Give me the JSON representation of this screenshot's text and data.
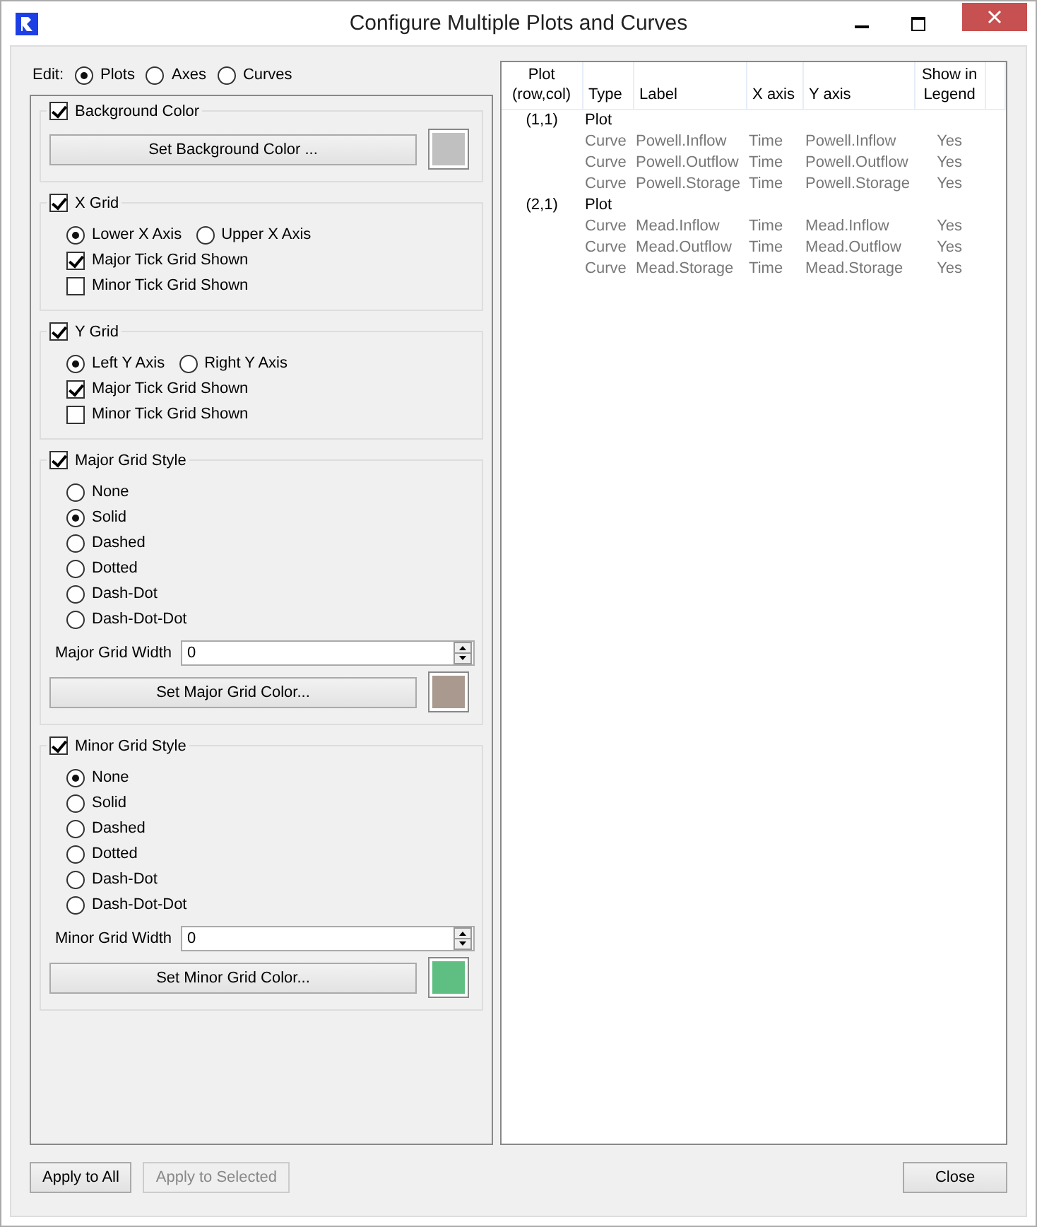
{
  "window": {
    "title": "Configure Multiple Plots and Curves"
  },
  "edit": {
    "label": "Edit:",
    "options": [
      {
        "label": "Plots",
        "selected": true
      },
      {
        "label": "Axes",
        "selected": false
      },
      {
        "label": "Curves",
        "selected": false
      }
    ]
  },
  "sections": [
    {
      "kind": "color",
      "label": "Background Color",
      "checked": true,
      "button": "Set Background Color ...",
      "color": "#c0c0c0"
    },
    {
      "kind": "grid",
      "label": "X Grid",
      "checked": true,
      "axes": [
        {
          "label": "Lower X Axis",
          "selected": true
        },
        {
          "label": "Upper X Axis",
          "selected": false
        }
      ],
      "options": [
        {
          "label": "Major Tick Grid Shown",
          "checked": true
        },
        {
          "label": "Minor Tick Grid Shown",
          "checked": false
        }
      ]
    },
    {
      "kind": "grid",
      "label": "Y Grid",
      "checked": true,
      "axes": [
        {
          "label": "Left Y Axis",
          "selected": true
        },
        {
          "label": "Right Y Axis",
          "selected": false
        }
      ],
      "options": [
        {
          "label": "Major Tick Grid Shown",
          "checked": true
        },
        {
          "label": "Minor Tick Grid Shown",
          "checked": false
        }
      ]
    },
    {
      "kind": "style",
      "label": "Major Grid Style",
      "checked": true,
      "styles": [
        {
          "label": "None",
          "selected": false
        },
        {
          "label": "Solid",
          "selected": true
        },
        {
          "label": "Dashed",
          "selected": false
        },
        {
          "label": "Dotted",
          "selected": false
        },
        {
          "label": "Dash-Dot",
          "selected": false
        },
        {
          "label": "Dash-Dot-Dot",
          "selected": false
        }
      ],
      "width_label": "Major Grid Width",
      "width_value": "0",
      "button": "Set Major Grid Color...",
      "color": "#a9998f"
    },
    {
      "kind": "style",
      "label": "Minor Grid Style",
      "checked": true,
      "styles": [
        {
          "label": "None",
          "selected": true
        },
        {
          "label": "Solid",
          "selected": false
        },
        {
          "label": "Dashed",
          "selected": false
        },
        {
          "label": "Dotted",
          "selected": false
        },
        {
          "label": "Dash-Dot",
          "selected": false
        },
        {
          "label": "Dash-Dot-Dot",
          "selected": false
        }
      ],
      "width_label": "Minor Grid Width",
      "width_value": "0",
      "button": "Set Minor Grid Color...",
      "color": "#5fbf82"
    }
  ],
  "table": {
    "columns": [
      {
        "line1": "Plot",
        "line2": "(row,col)"
      },
      {
        "line2": "Type"
      },
      {
        "line2": "Label"
      },
      {
        "line2": "X axis"
      },
      {
        "line2": "Y axis"
      },
      {
        "line1": "Show in",
        "line2": "Legend"
      }
    ],
    "rows": [
      {
        "kind": "plot",
        "plot": "(1,1)",
        "type": "Plot"
      },
      {
        "kind": "curve",
        "type": "Curve",
        "label": "Powell.Inflow",
        "x_axis": "Time",
        "y_axis": "Powell.Inflow",
        "legend": "Yes"
      },
      {
        "kind": "curve",
        "type": "Curve",
        "label": "Powell.Outflow",
        "x_axis": "Time",
        "y_axis": "Powell.Outflow",
        "legend": "Yes"
      },
      {
        "kind": "curve",
        "type": "Curve",
        "label": "Powell.Storage",
        "x_axis": "Time",
        "y_axis": "Powell.Storage",
        "legend": "Yes"
      },
      {
        "kind": "plot",
        "plot": "(2,1)",
        "type": "Plot"
      },
      {
        "kind": "curve",
        "type": "Curve",
        "label": "Mead.Inflow",
        "x_axis": "Time",
        "y_axis": "Mead.Inflow",
        "legend": "Yes"
      },
      {
        "kind": "curve",
        "type": "Curve",
        "label": "Mead.Outflow",
        "x_axis": "Time",
        "y_axis": "Mead.Outflow",
        "legend": "Yes"
      },
      {
        "kind": "curve",
        "type": "Curve",
        "label": "Mead.Storage",
        "x_axis": "Time",
        "y_axis": "Mead.Storage",
        "legend": "Yes"
      }
    ]
  },
  "footer": {
    "buttons": [
      {
        "label": "Apply to All",
        "disabled": false
      },
      {
        "label": "Apply to Selected",
        "disabled": true
      }
    ],
    "close": "Close"
  }
}
